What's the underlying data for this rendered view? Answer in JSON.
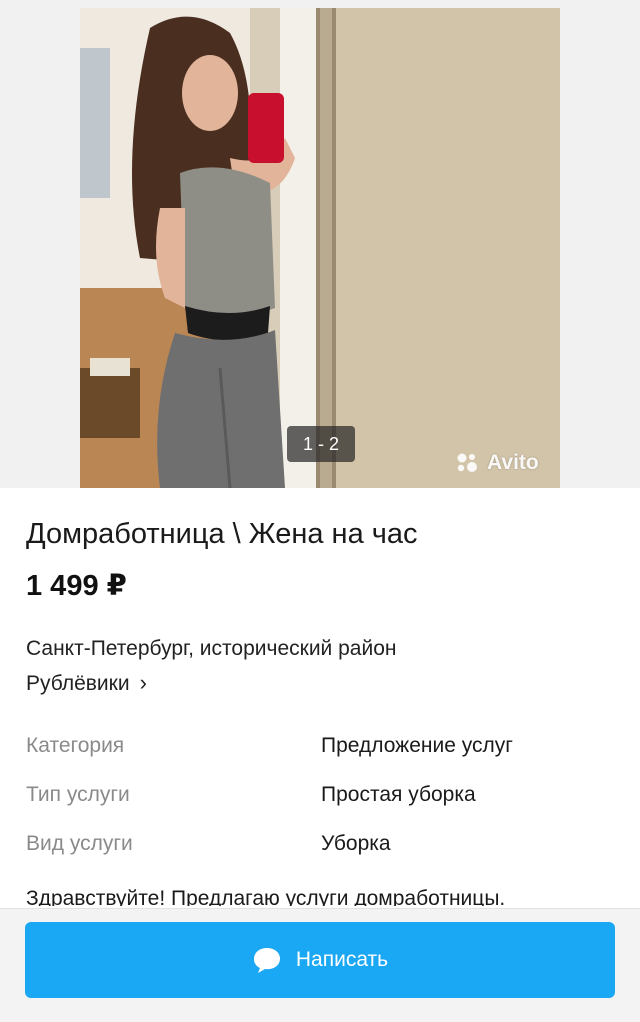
{
  "gallery": {
    "counter": "1 - 2",
    "watermark": "Avito",
    "photo_icon": "listing-photo"
  },
  "listing": {
    "title": "Домработница \\ Жена на час",
    "price": "1 499 ₽",
    "location_line1": "Санкт-Петербург, исторический район",
    "location_line2": "Рублёвики",
    "location_chevron": "›"
  },
  "params": [
    {
      "key": "Категория",
      "value": "Предложение услуг"
    },
    {
      "key": "Тип услуги",
      "value": "Простая уборка"
    },
    {
      "key": "Вид услуги",
      "value": "Уборка"
    }
  ],
  "description": "Здравствуйте! Предлагаю услуги домработницы.",
  "actions": {
    "write_label": "Написать",
    "write_icon": "chat-bubble-icon"
  },
  "colors": {
    "accent": "#1aa7f4",
    "muted_text": "#8a8a8a",
    "background": "#ffffff"
  }
}
